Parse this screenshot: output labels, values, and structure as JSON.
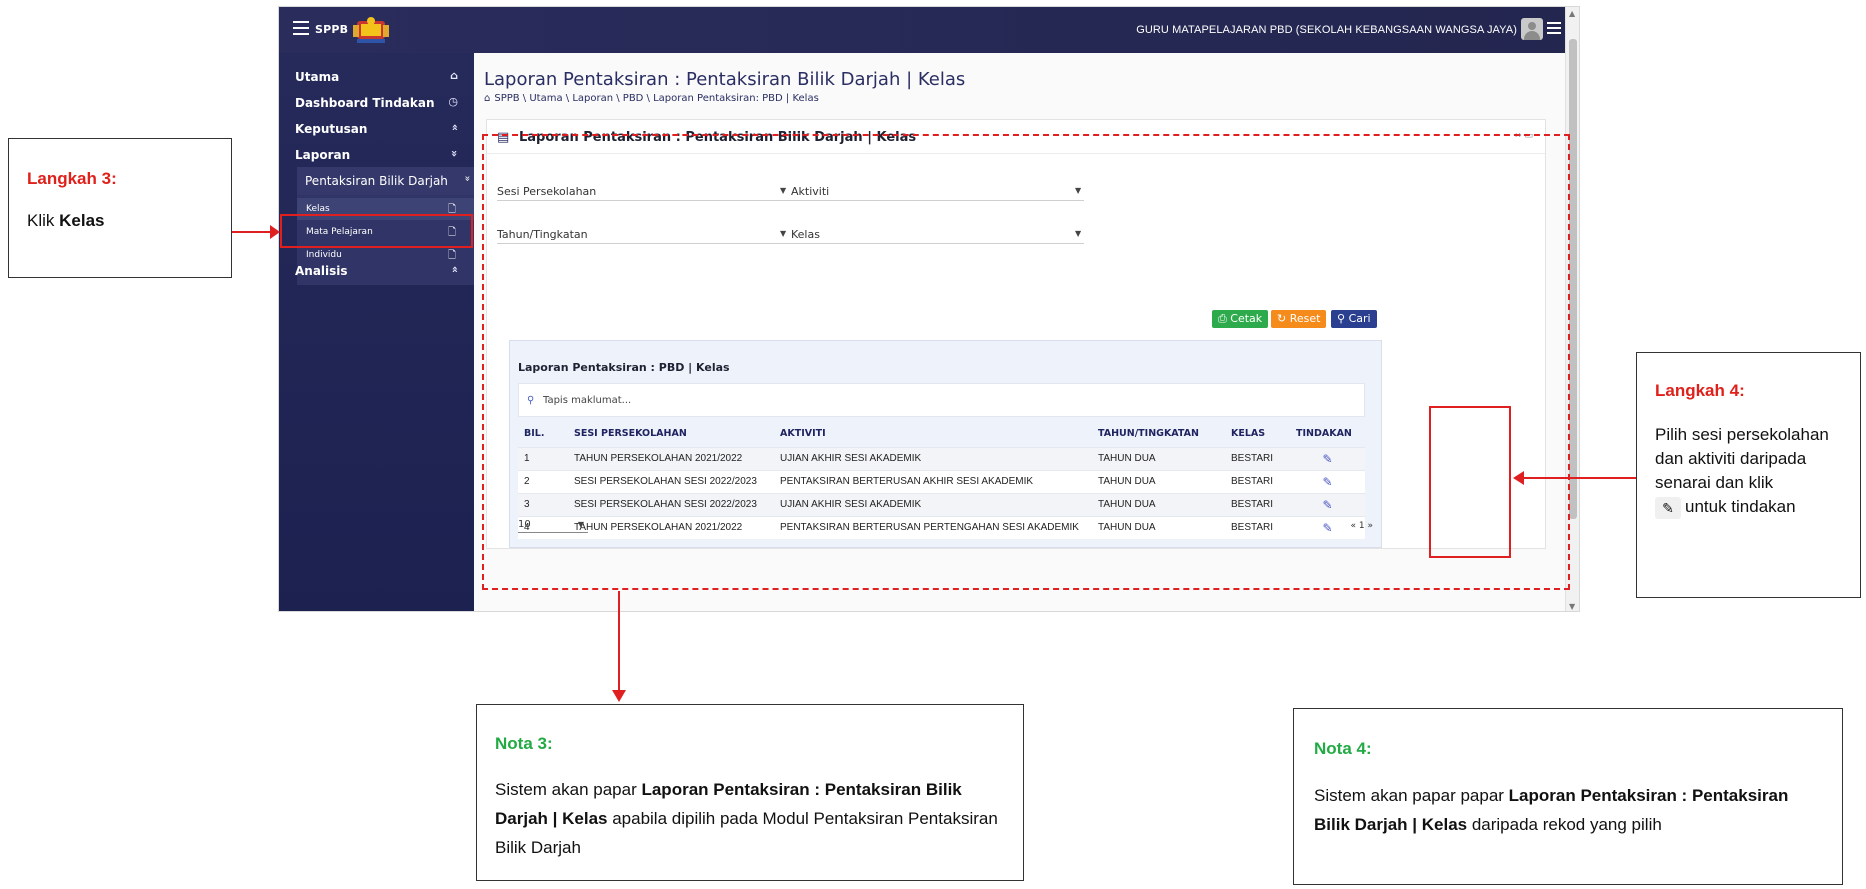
{
  "topbar": {
    "brand": "SPPB",
    "user_label": "GURU MATAPELAJARAN PBD (SEKOLAH KEBANGSAAN WANGSA JAYA)"
  },
  "sidebar": {
    "items": [
      {
        "label": "Utama",
        "icon": "home-icon",
        "glyph": "⌂"
      },
      {
        "label": "Dashboard Tindakan",
        "icon": "dashboard-icon",
        "glyph": "◷"
      },
      {
        "label": "Keputusan",
        "icon": "chevron-up-icon",
        "glyph": "»"
      },
      {
        "label": "Laporan",
        "icon": "chevron-down-icon",
        "glyph": "»"
      },
      {
        "label": "Analisis",
        "icon": "chevron-up-icon",
        "glyph": "»"
      }
    ],
    "pbd": {
      "label": "Pentaksiran Bilik Darjah",
      "glyph": "»"
    },
    "subitems": [
      {
        "label": "Kelas",
        "glyph": "🗋"
      },
      {
        "label": "Mata Pelajaran",
        "glyph": "🗋"
      },
      {
        "label": "Individu",
        "glyph": "🗋"
      }
    ]
  },
  "page": {
    "title": "Laporan Pentaksiran : Pentaksiran Bilik Darjah | Kelas",
    "breadcrumb": "SPPB \\ Utama \\ Laporan \\ PBD \\ Laporan Pentaksiran: PBD | Kelas"
  },
  "card": {
    "title": "Laporan Pentaksiran : Pentaksiran Bilik Darjah | Kelas",
    "fields": {
      "sesi_label": "Sesi Persekolahan",
      "aktiviti_placeholder": "Aktiviti",
      "tahun_label": "Tahun/Tingkatan",
      "kelas_placeholder": "Kelas"
    },
    "buttons": {
      "cetak": "Cetak",
      "reset": "Reset",
      "cari": "Cari"
    }
  },
  "table": {
    "title": "Laporan Pentaksiran : PBD | Kelas",
    "search_placeholder": "Tapis maklumat...",
    "headers": [
      "BIL.",
      "SESI PERSEKOLAHAN",
      "AKTIVITI",
      "TAHUN/TINGKATAN",
      "KELAS",
      "TINDAKAN"
    ],
    "rows": [
      [
        "1",
        "TAHUN PERSEKOLAHAN 2021/2022",
        "UJIAN AKHIR SESI AKADEMIK",
        "TAHUN DUA",
        "BESTARI"
      ],
      [
        "2",
        "SESI PERSEKOLAHAN SESI 2022/2023",
        "PENTAKSIRAN BERTERUSAN AKHIR SESI AKADEMIK",
        "TAHUN DUA",
        "BESTARI"
      ],
      [
        "3",
        "SESI PERSEKOLAHAN SESI 2022/2023",
        "UJIAN AKHIR SESI AKADEMIK",
        "TAHUN DUA",
        "BESTARI"
      ],
      [
        "4",
        "TAHUN PERSEKOLAHAN 2021/2022",
        "PENTAKSIRAN BERTERUSAN PERTENGAHAN SESI AKADEMIK",
        "TAHUN DUA",
        "BESTARI"
      ]
    ],
    "per_page": "10",
    "pager": "« 1 »"
  },
  "callouts": {
    "step3": {
      "head": "Langkah 3:",
      "body_pre": "Klik ",
      "body_bold": "Kelas"
    },
    "step4": {
      "head": "Langkah 4:",
      "body": "Pilih sesi persekolahan dan aktiviti daripada senarai dan klik",
      "tail": "untuk tindakan"
    },
    "note3": {
      "head": "Nota 3:",
      "pre": "Sistem akan papar ",
      "bold": "Laporan Pentaksiran : Pentaksiran Bilik Darjah | Kelas",
      "post": " apabila dipilih pada Modul Pentaksiran Pentaksiran Bilik Darjah"
    },
    "note4": {
      "head": "Nota 4:",
      "pre": "Sistem akan papar papar ",
      "bold": "Laporan Pentaksiran : Pentaksiran Bilik Darjah | Kelas",
      "post": " daripada rekod yang pilih"
    }
  },
  "colors": {
    "accent_red": "#e0201a",
    "note_green": "#22aa44",
    "sidebar_navy": "#262a5a",
    "btn_cetak": "#2dab4c",
    "btn_reset": "#f58b1a",
    "btn_cari": "#2a3f8f"
  }
}
